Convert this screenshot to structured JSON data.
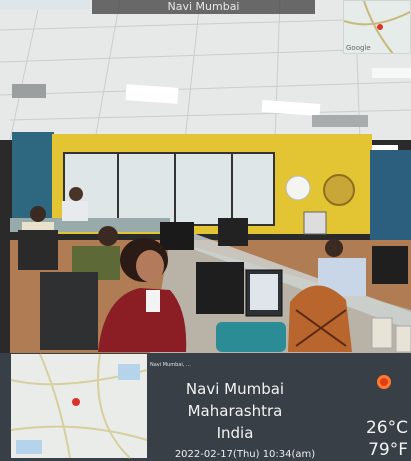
{
  "top_bar": {
    "title": "Navi Mumbai"
  },
  "map_thumb": {
    "logo": "Google"
  },
  "gps_overlay": {
    "fine_print": "Navi Mumbai, ...",
    "city": "Navi Mumbai",
    "state": "Maharashtra",
    "country": "India",
    "datetime": "2022-02-17(Thu)   10:34(am)",
    "temp_c": "26°C",
    "temp_f": "79°F",
    "weather_icon": "sun-icon"
  },
  "colors": {
    "wall_yellow": "#e2c534",
    "wall_teal": "#2a5f76",
    "ceiling": "#e9eceb",
    "sweater_red": "#8a1e24"
  }
}
